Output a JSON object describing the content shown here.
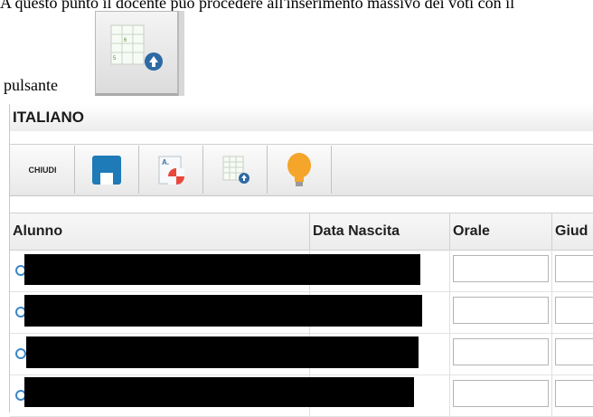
{
  "doc": {
    "intro_text": "A questo punto il docente può procedere all'inserimento massivo dei voti con il",
    "pulsante_text": "pulsante"
  },
  "panel": {
    "subject_title": "ITALIANO",
    "toolbar": {
      "chiudi_label": "CHIUDI",
      "icons": [
        "save-icon",
        "report-icon",
        "grid-add-icon",
        "lightbulb-icon"
      ]
    },
    "table": {
      "columns": [
        "Alunno",
        "Data Nascita",
        "Orale",
        "Giud"
      ],
      "rows": [
        {
          "alunno": "",
          "data_nascita": "",
          "orale": "",
          "giudizio": ""
        },
        {
          "alunno": "",
          "data_nascita": "",
          "orale": "",
          "giudizio": ""
        },
        {
          "alunno": "",
          "data_nascita": "",
          "orale": "",
          "giudizio": ""
        },
        {
          "alunno": "",
          "data_nascita": "",
          "orale": "",
          "giudizio": ""
        }
      ]
    }
  },
  "colors": {
    "radio_accent": "#3b86c7",
    "save_icon": "#1f7ab8",
    "lightbulb": "#f4a52a",
    "report_red": "#e8473b"
  }
}
